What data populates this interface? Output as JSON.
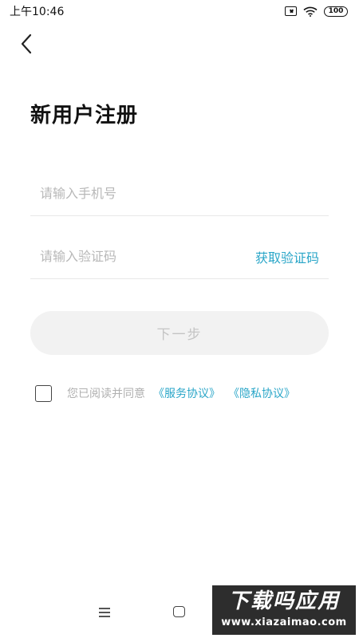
{
  "status_bar": {
    "time": "上午10:46",
    "battery": "100",
    "icons": [
      "sim-off-icon",
      "wifi-icon",
      "battery-icon"
    ]
  },
  "header": {
    "back_icon": "chevron-left-icon",
    "title": "新用户注册"
  },
  "form": {
    "phone_placeholder": "请输入手机号",
    "phone_value": "",
    "code_placeholder": "请输入验证码",
    "code_value": "",
    "get_code_label": "获取验证码",
    "next_label": "下一步"
  },
  "agreement": {
    "checked": false,
    "text": "您已阅读并同意",
    "service_link": "《服务协议》",
    "privacy_link": "《隐私协议》"
  },
  "colors": {
    "accent": "#2aa6c8",
    "button_disabled_bg": "#f2f2f2",
    "placeholder": "#b8b8b8"
  },
  "watermark": {
    "title": "下载吗应用",
    "url": "www.xiazaimao.com"
  }
}
